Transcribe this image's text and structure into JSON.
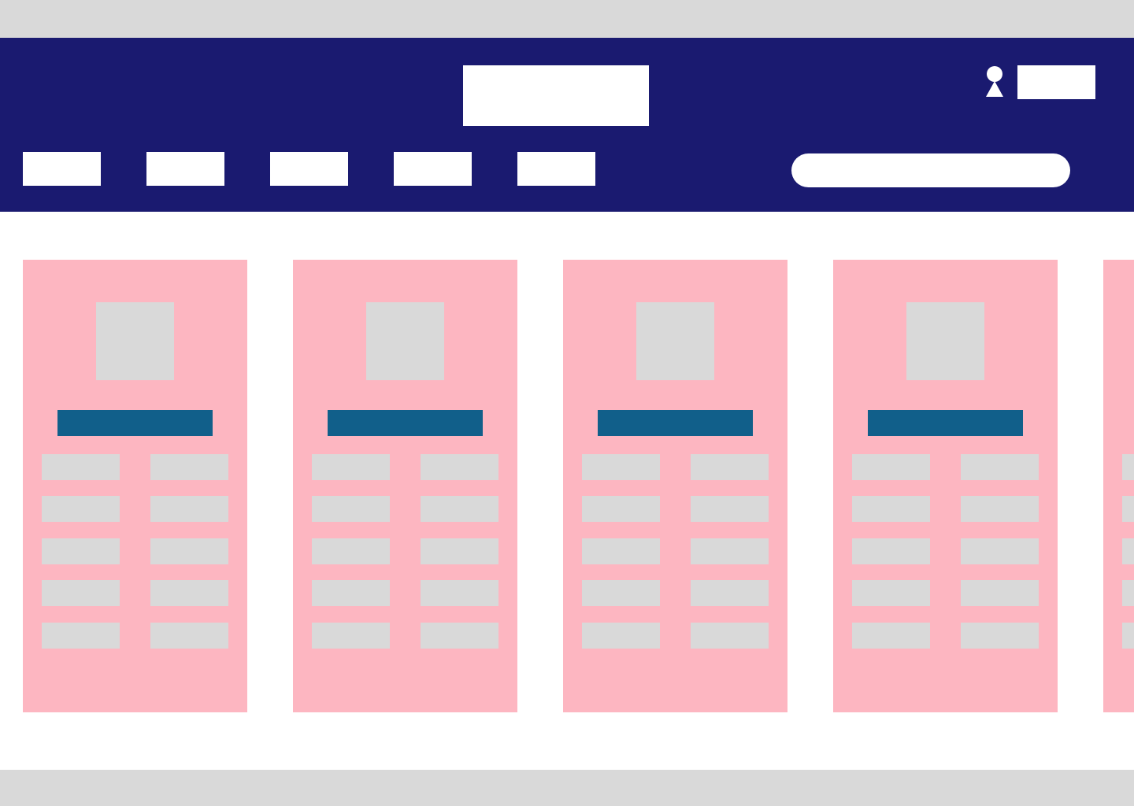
{
  "header": {
    "logo_text": "",
    "account_label": "",
    "nav": [
      {
        "label": ""
      },
      {
        "label": ""
      },
      {
        "label": ""
      },
      {
        "label": ""
      },
      {
        "label": ""
      }
    ],
    "search": {
      "placeholder": "",
      "value": ""
    }
  },
  "cards": [
    {
      "title": "",
      "fields": [
        "",
        "",
        "",
        "",
        "",
        "",
        "",
        "",
        "",
        ""
      ]
    },
    {
      "title": "",
      "fields": [
        "",
        "",
        "",
        "",
        "",
        "",
        "",
        "",
        "",
        ""
      ]
    },
    {
      "title": "",
      "fields": [
        "",
        "",
        "",
        "",
        "",
        "",
        "",
        "",
        "",
        ""
      ]
    },
    {
      "title": "",
      "fields": [
        "",
        "",
        "",
        "",
        "",
        "",
        "",
        "",
        "",
        ""
      ]
    }
  ],
  "colors": {
    "header_bg": "#1a1a70",
    "card_bg": "#fdb6c1",
    "card_title_bar": "#115f8a",
    "placeholder_gray": "#d9d9d9",
    "page_bg": "#ffffff"
  },
  "icons": {
    "user": "user-icon"
  }
}
